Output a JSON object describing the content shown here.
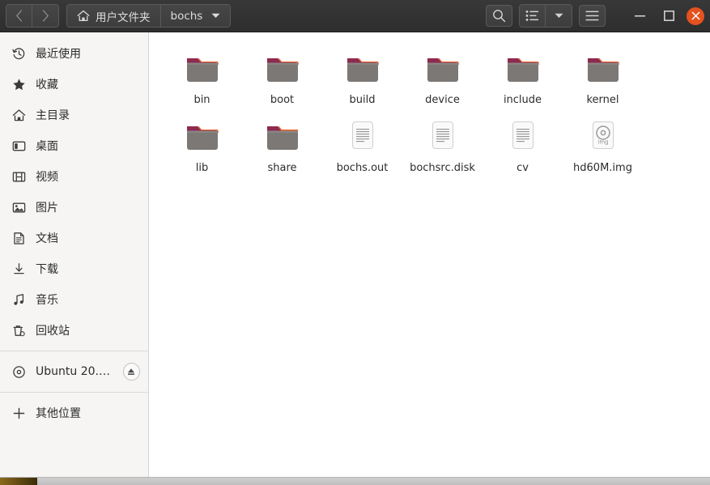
{
  "window": {
    "title": "bochs",
    "nav": {
      "back_label": "‹",
      "forward_label": "›"
    },
    "breadcrumbs": [
      {
        "label": "用户文件夹",
        "icon": "home-icon"
      },
      {
        "label": "bochs",
        "icon": "chevron-down-icon"
      }
    ],
    "toolbar": {
      "search_label": "search-icon",
      "view_list_label": "list-view-icon",
      "view_dropdown_label": "chevron-down-icon",
      "menu_label": "hamburger-menu-icon"
    },
    "controls": {
      "minimize_label": "—",
      "maximize_label": "□",
      "close_label": "×",
      "close_color": "#e4521e"
    }
  },
  "sidebar": {
    "items": [
      {
        "label": "最近使用",
        "icon": "clock-icon"
      },
      {
        "label": "收藏",
        "icon": "star-icon"
      },
      {
        "label": "主目录",
        "icon": "home-icon"
      },
      {
        "label": "桌面",
        "icon": "desktop-icon"
      },
      {
        "label": "视频",
        "icon": "film-icon"
      },
      {
        "label": "图片",
        "icon": "image-icon"
      },
      {
        "label": "文档",
        "icon": "document-icon"
      },
      {
        "label": "下载",
        "icon": "download-icon"
      },
      {
        "label": "音乐",
        "icon": "music-icon"
      },
      {
        "label": "回收站",
        "icon": "trash-icon"
      }
    ],
    "drive": {
      "label": "Ubuntu 20.0…",
      "icon": "disc-icon",
      "eject_label": "eject-icon"
    },
    "other_locations": {
      "label": "其他位置",
      "icon": "plus-icon"
    }
  },
  "files": [
    {
      "name": "bin",
      "type": "folder"
    },
    {
      "name": "boot",
      "type": "folder"
    },
    {
      "name": "build",
      "type": "folder"
    },
    {
      "name": "device",
      "type": "folder"
    },
    {
      "name": "include",
      "type": "folder"
    },
    {
      "name": "kernel",
      "type": "folder"
    },
    {
      "name": "lib",
      "type": "folder"
    },
    {
      "name": "share",
      "type": "folder-plain"
    },
    {
      "name": "bochs.out",
      "type": "text"
    },
    {
      "name": "bochsrc.disk",
      "type": "text"
    },
    {
      "name": "cv",
      "type": "text"
    },
    {
      "name": "hd60M.img",
      "type": "disk-image",
      "badge": "img"
    }
  ],
  "colors": {
    "headerbar": "#303030",
    "sidebar": "#f6f5f4",
    "content": "#ffffff",
    "folder_body": "#7b7875",
    "folder_tab": "#8e2a4f",
    "folder_accent": "#e8622a",
    "close": "#e4521e"
  }
}
